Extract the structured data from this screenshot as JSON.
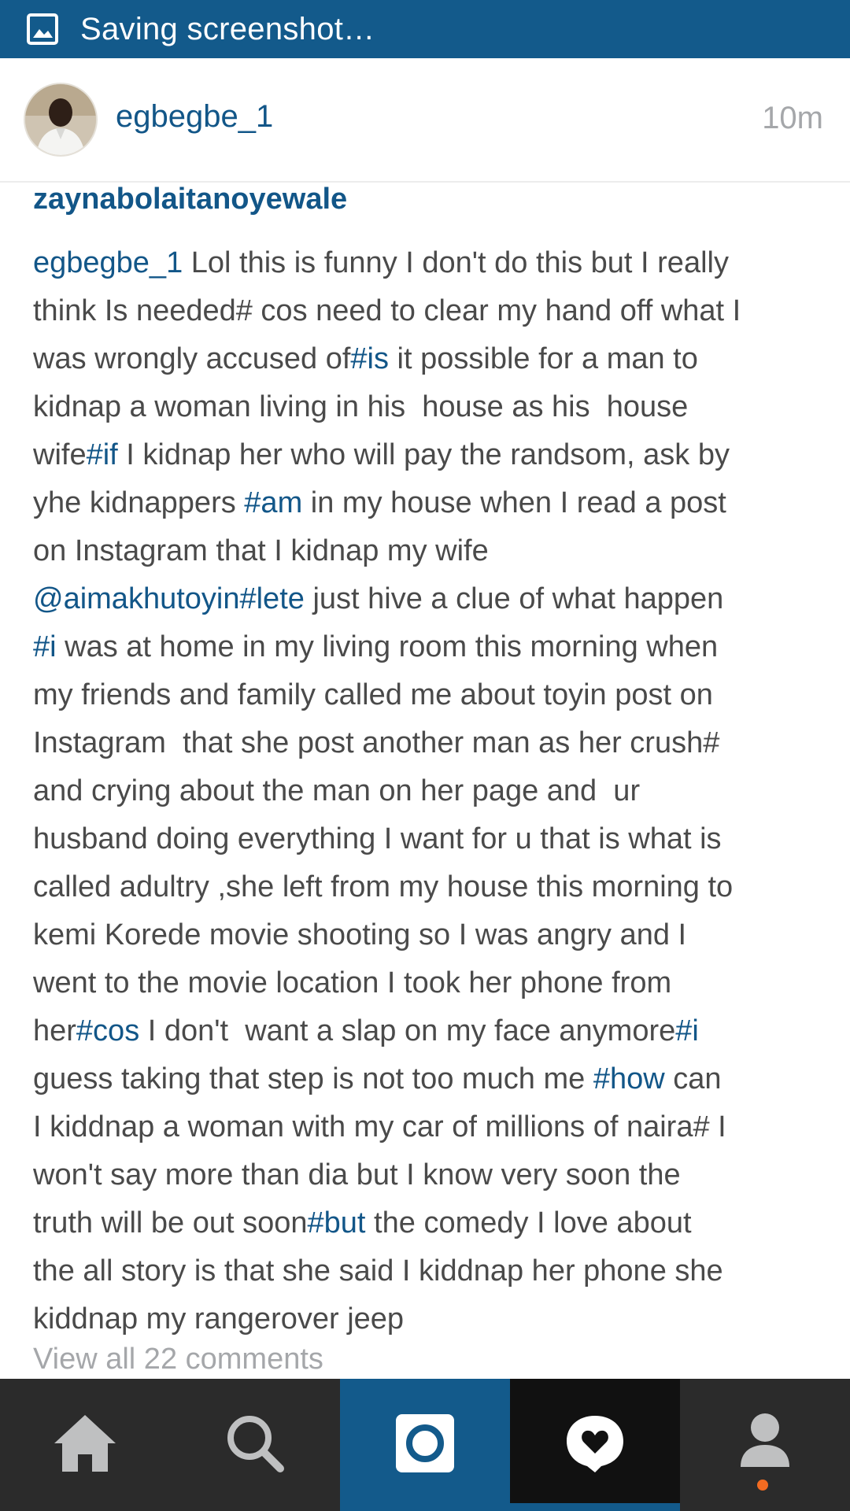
{
  "status_bar": {
    "text": "Saving screenshot…",
    "icon": "image-icon",
    "color": "#135a8b"
  },
  "post": {
    "username": "egbegbe_1",
    "time": "10m"
  },
  "comments": {
    "previous_user": "zaynabolaitanoyewale",
    "comment_user": "egbegbe_1",
    "lines": [
      [
        {
          "t": "egbegbe_1",
          "c": "u"
        },
        {
          "t": " Lol this is funny I don't do this but I really"
        }
      ],
      [
        {
          "t": "think Is needed# cos need to clear my hand off what I"
        }
      ],
      [
        {
          "t": "was wrongly accused of"
        },
        {
          "t": "#is",
          "c": "tag"
        },
        {
          "t": " it possible for a man to"
        }
      ],
      [
        {
          "t": "kidnap a woman living in his  house as his  house"
        }
      ],
      [
        {
          "t": "wife"
        },
        {
          "t": "#if",
          "c": "tag"
        },
        {
          "t": " I kidnap her who will pay the randsom, ask by"
        }
      ],
      [
        {
          "t": "yhe kidnappers "
        },
        {
          "t": "#am",
          "c": "tag"
        },
        {
          "t": " in my house when I read a post"
        }
      ],
      [
        {
          "t": "on Instagram that I kidnap my wife"
        }
      ],
      [
        {
          "t": "@aimakhutoyin",
          "c": "tag"
        },
        {
          "t": "#lete",
          "c": "tag"
        },
        {
          "t": " just hive a clue of what happen"
        }
      ],
      [
        {
          "t": "#i",
          "c": "tag"
        },
        {
          "t": " was at home in my living room this morning when"
        }
      ],
      [
        {
          "t": "my friends and family called me about toyin post on"
        }
      ],
      [
        {
          "t": "Instagram  that she post another man as her crush#"
        }
      ],
      [
        {
          "t": "and crying about the man on her page and  ur"
        }
      ],
      [
        {
          "t": "husband doing everything I want for u that is what is"
        }
      ],
      [
        {
          "t": "called adultry ,she left from my house this morning to"
        }
      ],
      [
        {
          "t": "kemi Korede movie shooting so I was angry and I"
        }
      ],
      [
        {
          "t": "went to the movie location I took her phone from"
        }
      ],
      [
        {
          "t": "her"
        },
        {
          "t": "#cos",
          "c": "tag"
        },
        {
          "t": " I don't  want a slap on my face anymore"
        },
        {
          "t": "#i",
          "c": "tag"
        }
      ],
      [
        {
          "t": "guess taking that step is not too much me "
        },
        {
          "t": "#how",
          "c": "tag"
        },
        {
          "t": " can"
        }
      ],
      [
        {
          "t": "I kiddnap a woman with my car of millions of naira# I"
        }
      ],
      [
        {
          "t": "won't say more than dia but I know very soon the"
        }
      ],
      [
        {
          "t": "truth will be out soon"
        },
        {
          "t": "#but",
          "c": "tag"
        },
        {
          "t": " the comedy I love about"
        }
      ],
      [
        {
          "t": "the all story is that she said I kiddnap her phone she"
        }
      ],
      [
        {
          "t": "kiddnap my rangerover jeep"
        }
      ]
    ],
    "view_all": "View all 22 comments"
  },
  "bottom_nav": {
    "tabs": [
      {
        "name": "home",
        "icon": "home-icon"
      },
      {
        "name": "search",
        "icon": "search-icon"
      },
      {
        "name": "camera",
        "icon": "camera-icon",
        "active": true
      },
      {
        "name": "activity",
        "icon": "heart-bubble-icon",
        "active": true
      },
      {
        "name": "profile",
        "icon": "person-icon",
        "has_notification": true
      }
    ],
    "accent_color": "#135a8b",
    "notification_color": "#f26b21"
  }
}
